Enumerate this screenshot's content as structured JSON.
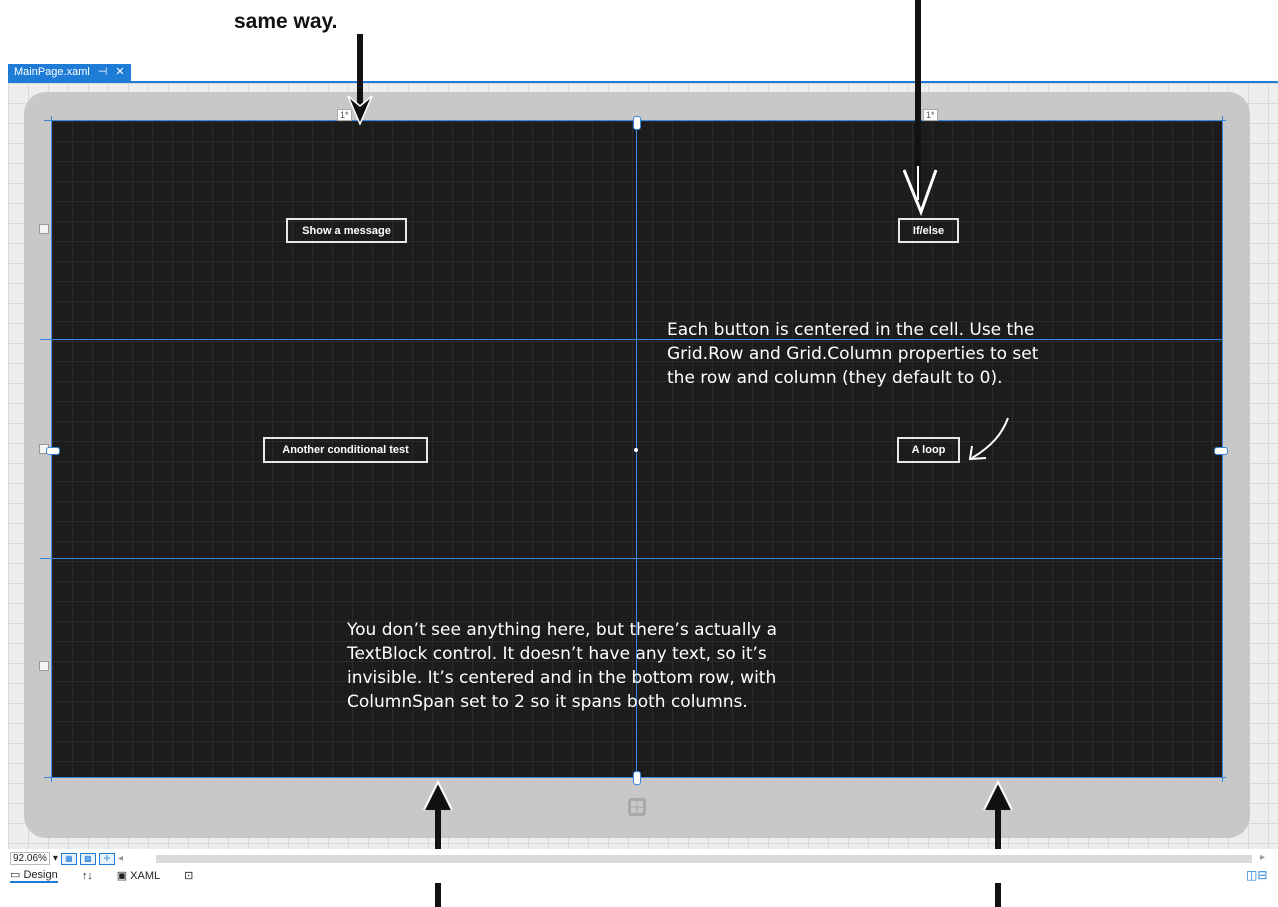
{
  "annotations": {
    "top_left_caption_line1": "",
    "top_left_caption_line2": "same way.",
    "right_note": [
      "Each button is centered in the cell. Use the",
      "Grid.Row and Grid.Column properties to set",
      "the row and column (they default to 0)."
    ],
    "bottom_note": [
      "You don’t see anything here, but there’s actually a",
      "TextBlock control. It doesn’t have any text, so it’s",
      "invisible. It’s centered and in the bottom row, with",
      "ColumnSpan set to 2 so it spans both columns."
    ]
  },
  "document_tab": {
    "title": "MainPage.xaml",
    "pin_glyph": "⊣",
    "close_glyph": "✕"
  },
  "grid": {
    "column_headers": [
      "1*",
      "1*"
    ],
    "buttons": [
      {
        "label": "Show a message"
      },
      {
        "label": "If/else"
      },
      {
        "label": "Another conditional test"
      },
      {
        "label": "A loop"
      }
    ]
  },
  "bottom_bar": {
    "zoom": "92.06%",
    "zoom_caret": "▾",
    "design_tab": "Design",
    "swap_glyph": "↑↓",
    "xaml_tab": "XAML"
  },
  "icons": [
    "windows-logo-icon",
    "grid-view-icon",
    "snap-icon",
    "split-view-icon"
  ]
}
